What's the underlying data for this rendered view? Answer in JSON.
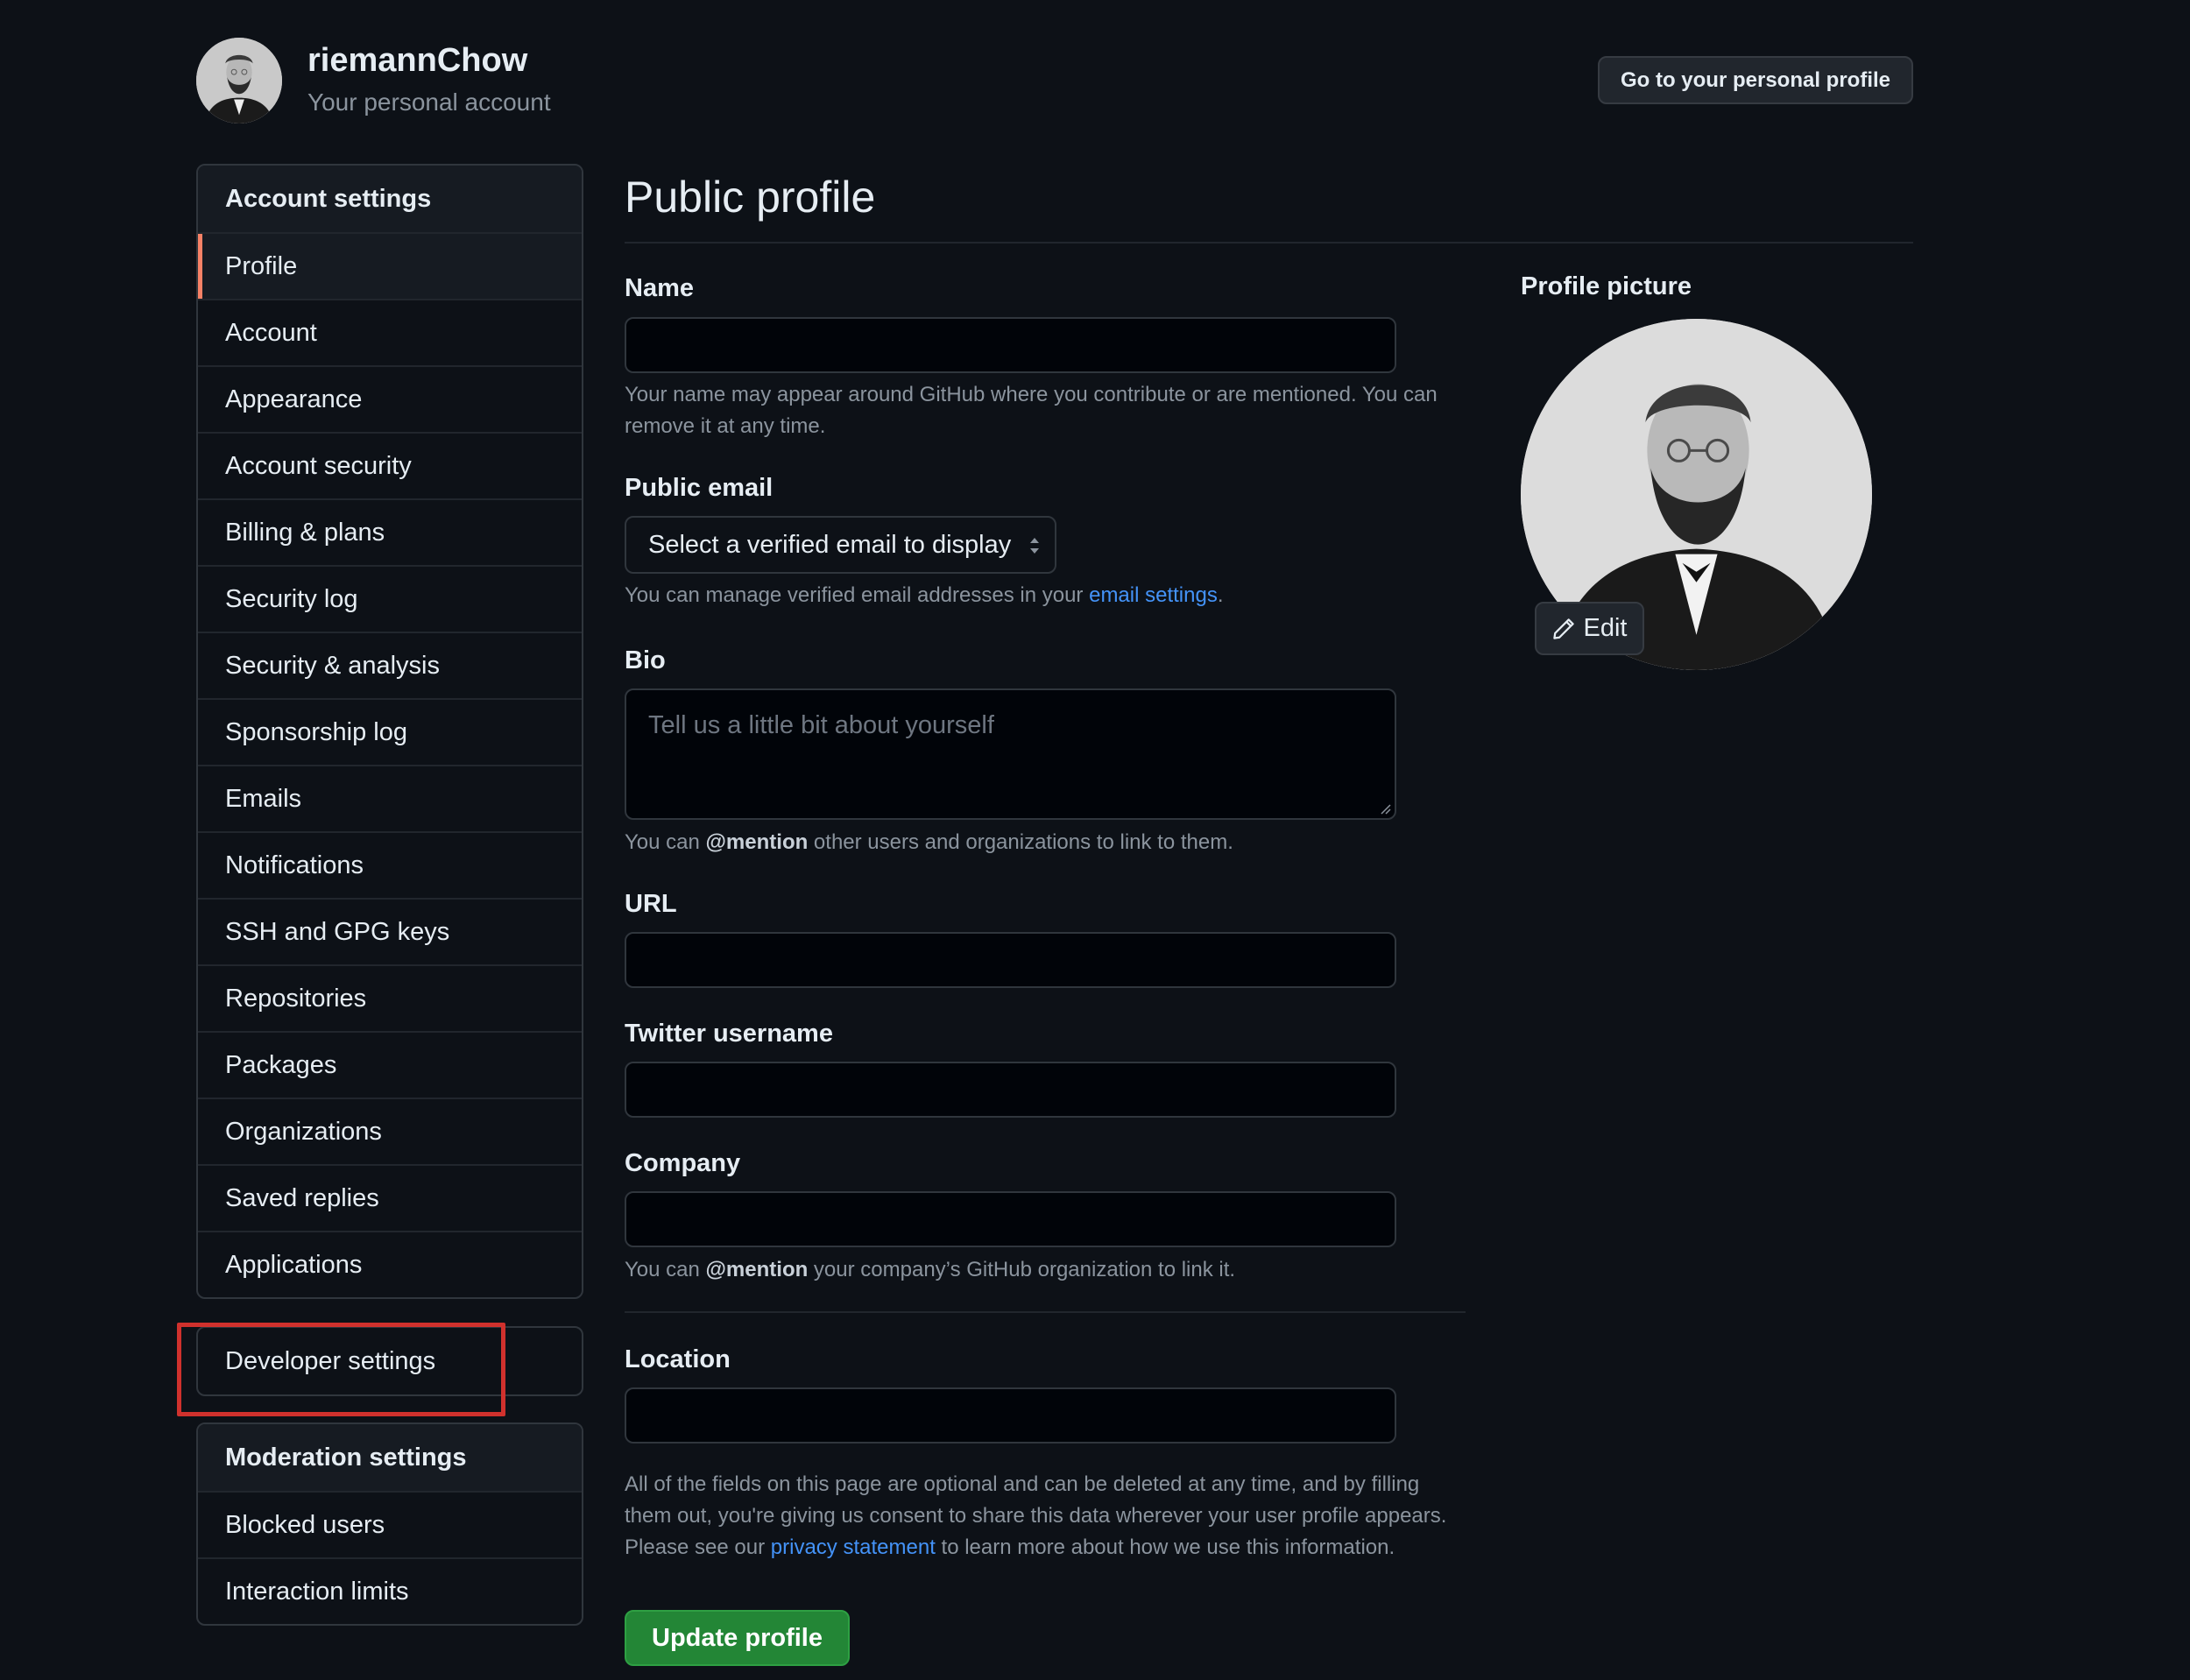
{
  "header": {
    "username": "riemannChow",
    "subtitle": "Your personal account",
    "profile_button": "Go to your personal profile"
  },
  "sidebar": {
    "account_heading": "Account settings",
    "items": [
      {
        "label": "Profile",
        "selected": true
      },
      {
        "label": "Account"
      },
      {
        "label": "Appearance"
      },
      {
        "label": "Account security"
      },
      {
        "label": "Billing & plans"
      },
      {
        "label": "Security log"
      },
      {
        "label": "Security & analysis"
      },
      {
        "label": "Sponsorship log"
      },
      {
        "label": "Emails"
      },
      {
        "label": "Notifications"
      },
      {
        "label": "SSH and GPG keys"
      },
      {
        "label": "Repositories"
      },
      {
        "label": "Packages"
      },
      {
        "label": "Organizations"
      },
      {
        "label": "Saved replies"
      },
      {
        "label": "Applications"
      }
    ],
    "developer_settings": "Developer settings",
    "moderation_heading": "Moderation settings",
    "moderation_items": [
      {
        "label": "Blocked users"
      },
      {
        "label": "Interaction limits"
      }
    ],
    "highlight_color": "#d0312d"
  },
  "main": {
    "title": "Public profile",
    "name": {
      "label": "Name",
      "value": "",
      "note": "Your name may appear around GitHub where you contribute or are mentioned. You can remove it at any time."
    },
    "public_email": {
      "label": "Public email",
      "selected": "Select a verified email to display",
      "note_prefix": "You can manage verified email addresses in your ",
      "note_link": "email settings",
      "note_suffix": "."
    },
    "bio": {
      "label": "Bio",
      "placeholder": "Tell us a little bit about yourself",
      "note_prefix": "You can ",
      "note_bold": "@mention",
      "note_suffix": " other users and organizations to link to them."
    },
    "url": {
      "label": "URL",
      "value": ""
    },
    "twitter": {
      "label": "Twitter username",
      "value": ""
    },
    "company": {
      "label": "Company",
      "value": "",
      "note_prefix": "You can ",
      "note_bold": "@mention",
      "note_suffix": " your company’s GitHub organization to link it."
    },
    "location": {
      "label": "Location",
      "value": ""
    },
    "disclaimer_prefix": "All of the fields on this page are optional and can be deleted at any time, and by filling them out, you're giving us consent to share this data wherever your user profile appears. Please see our ",
    "disclaimer_link": "privacy statement",
    "disclaimer_suffix": " to learn more about how we use this information.",
    "update_button": "Update profile"
  },
  "profile_picture": {
    "label": "Profile picture",
    "edit_button": "Edit"
  },
  "colors": {
    "background": "#0d1117",
    "accent_link": "#4493f8",
    "primary_button": "#238636",
    "selected_indicator": "#f78166"
  }
}
